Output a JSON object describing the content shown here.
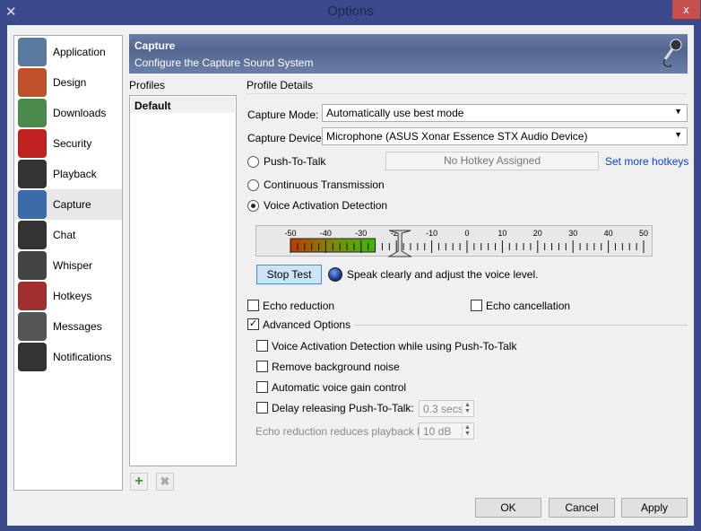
{
  "window": {
    "title": "Options",
    "close": "x"
  },
  "nav": {
    "items": [
      {
        "label": "Application",
        "icon": "application-icon",
        "color": "#5a7aa0"
      },
      {
        "label": "Design",
        "icon": "design-icon",
        "color": "#c0502a"
      },
      {
        "label": "Downloads",
        "icon": "downloads-icon",
        "color": "#4a8a4a"
      },
      {
        "label": "Security",
        "icon": "security-lock-icon",
        "color": "#c02020"
      },
      {
        "label": "Playback",
        "icon": "speaker-icon",
        "color": "#333333"
      },
      {
        "label": "Capture",
        "icon": "microphone-icon",
        "color": "#3a6aa8"
      },
      {
        "label": "Chat",
        "icon": "chat-icon",
        "color": "#333333"
      },
      {
        "label": "Whisper",
        "icon": "headset-icon",
        "color": "#444444"
      },
      {
        "label": "Hotkeys",
        "icon": "hotkeys-icon",
        "color": "#a03030"
      },
      {
        "label": "Messages",
        "icon": "messages-icon",
        "color": "#555555"
      },
      {
        "label": "Notifications",
        "icon": "notifications-icon",
        "color": "#333333"
      }
    ],
    "selected": "Capture"
  },
  "banner": {
    "title": "Capture",
    "subtitle": "Configure the Capture Sound System"
  },
  "profiles": {
    "label": "Profiles",
    "items": [
      "Default"
    ],
    "add": "+",
    "remove": "✖"
  },
  "details": {
    "label": "Profile Details",
    "capture_mode_label": "Capture Mode:",
    "capture_mode": "Automatically use best mode",
    "capture_device_label": "Capture Device:",
    "capture_device": "Microphone (ASUS Xonar Essence STX Audio Device)",
    "ptt": "Push-To-Talk",
    "hotkey": "No Hotkey Assigned",
    "more_hotkeys": "Set more hotkeys",
    "continuous": "Continuous Transmission",
    "vad": "Voice Activation Detection",
    "selected_mode": "Voice Activation Detection",
    "meter": {
      "ticks": [
        "-50",
        "-40",
        "-30",
        "-20",
        "-10",
        "0",
        "10",
        "20",
        "30",
        "40",
        "50"
      ],
      "level_db": -26,
      "threshold_db": -19,
      "min": -50,
      "max": 50
    },
    "stop_test": "Stop Test",
    "hint": "Speak clearly and adjust the voice level.",
    "echo_reduction": "Echo reduction",
    "echo_cancellation": "Echo cancellation",
    "advanced": "Advanced Options",
    "advanced_checked": true,
    "vad_ptt": "Voice Activation Detection while using Push-To-Talk",
    "remove_noise": "Remove background noise",
    "agc": "Automatic voice gain control",
    "delay_ptt": "Delay releasing Push-To-Talk:",
    "delay_value": "0.3 secs",
    "echo_red_by": "Echo reduction reduces playback by:",
    "echo_red_value": "10 dB"
  },
  "buttons": {
    "ok": "OK",
    "cancel": "Cancel",
    "apply": "Apply"
  }
}
